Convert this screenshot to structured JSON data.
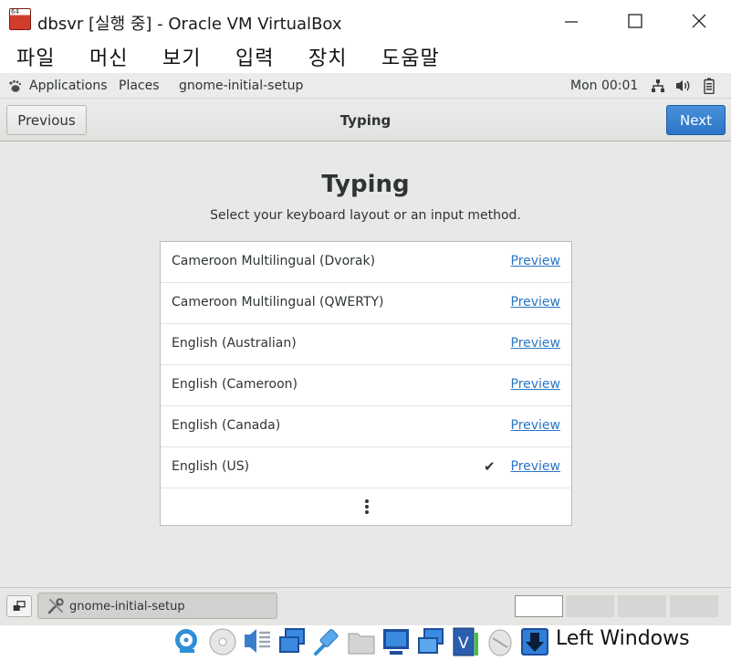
{
  "window": {
    "title": "dbsvr [실행 중] - Oracle VM VirtualBox"
  },
  "menubar": {
    "items": [
      "파일",
      "머신",
      "보기",
      "입력",
      "장치",
      "도움말"
    ]
  },
  "gnome_topbar": {
    "applications": "Applications",
    "places": "Places",
    "app_name": "gnome-initial-setup",
    "clock": "Mon 00:01"
  },
  "headerbar": {
    "previous_label": "Previous",
    "title": "Typing",
    "next_label": "Next",
    "accent_color": "#3584e4"
  },
  "main": {
    "heading": "Typing",
    "subtitle": "Select your keyboard layout or an input method.",
    "layouts": [
      {
        "name": "Cameroon Multilingual (Dvorak)",
        "preview": "Preview",
        "selected": false
      },
      {
        "name": "Cameroon Multilingual (QWERTY)",
        "preview": "Preview",
        "selected": false
      },
      {
        "name": "English (Australian)",
        "preview": "Preview",
        "selected": false
      },
      {
        "name": "English (Cameroon)",
        "preview": "Preview",
        "selected": false
      },
      {
        "name": "English (Canada)",
        "preview": "Preview",
        "selected": false
      },
      {
        "name": "English (US)",
        "preview": "Preview",
        "selected": true
      }
    ]
  },
  "bottombar": {
    "task_label": "gnome-initial-setup",
    "workspaces": 4,
    "active_workspace": 1
  },
  "statusbar": {
    "host_key": "Left Windows",
    "icons": [
      "hard-disk-icon",
      "optical-drive-icon",
      "audio-icon",
      "network-icon",
      "usb-icon",
      "shared-folder-icon",
      "display-icon",
      "screen-capture-icon",
      "video-capture-icon",
      "mouse-integration-icon",
      "host-key-arrow-icon"
    ]
  }
}
